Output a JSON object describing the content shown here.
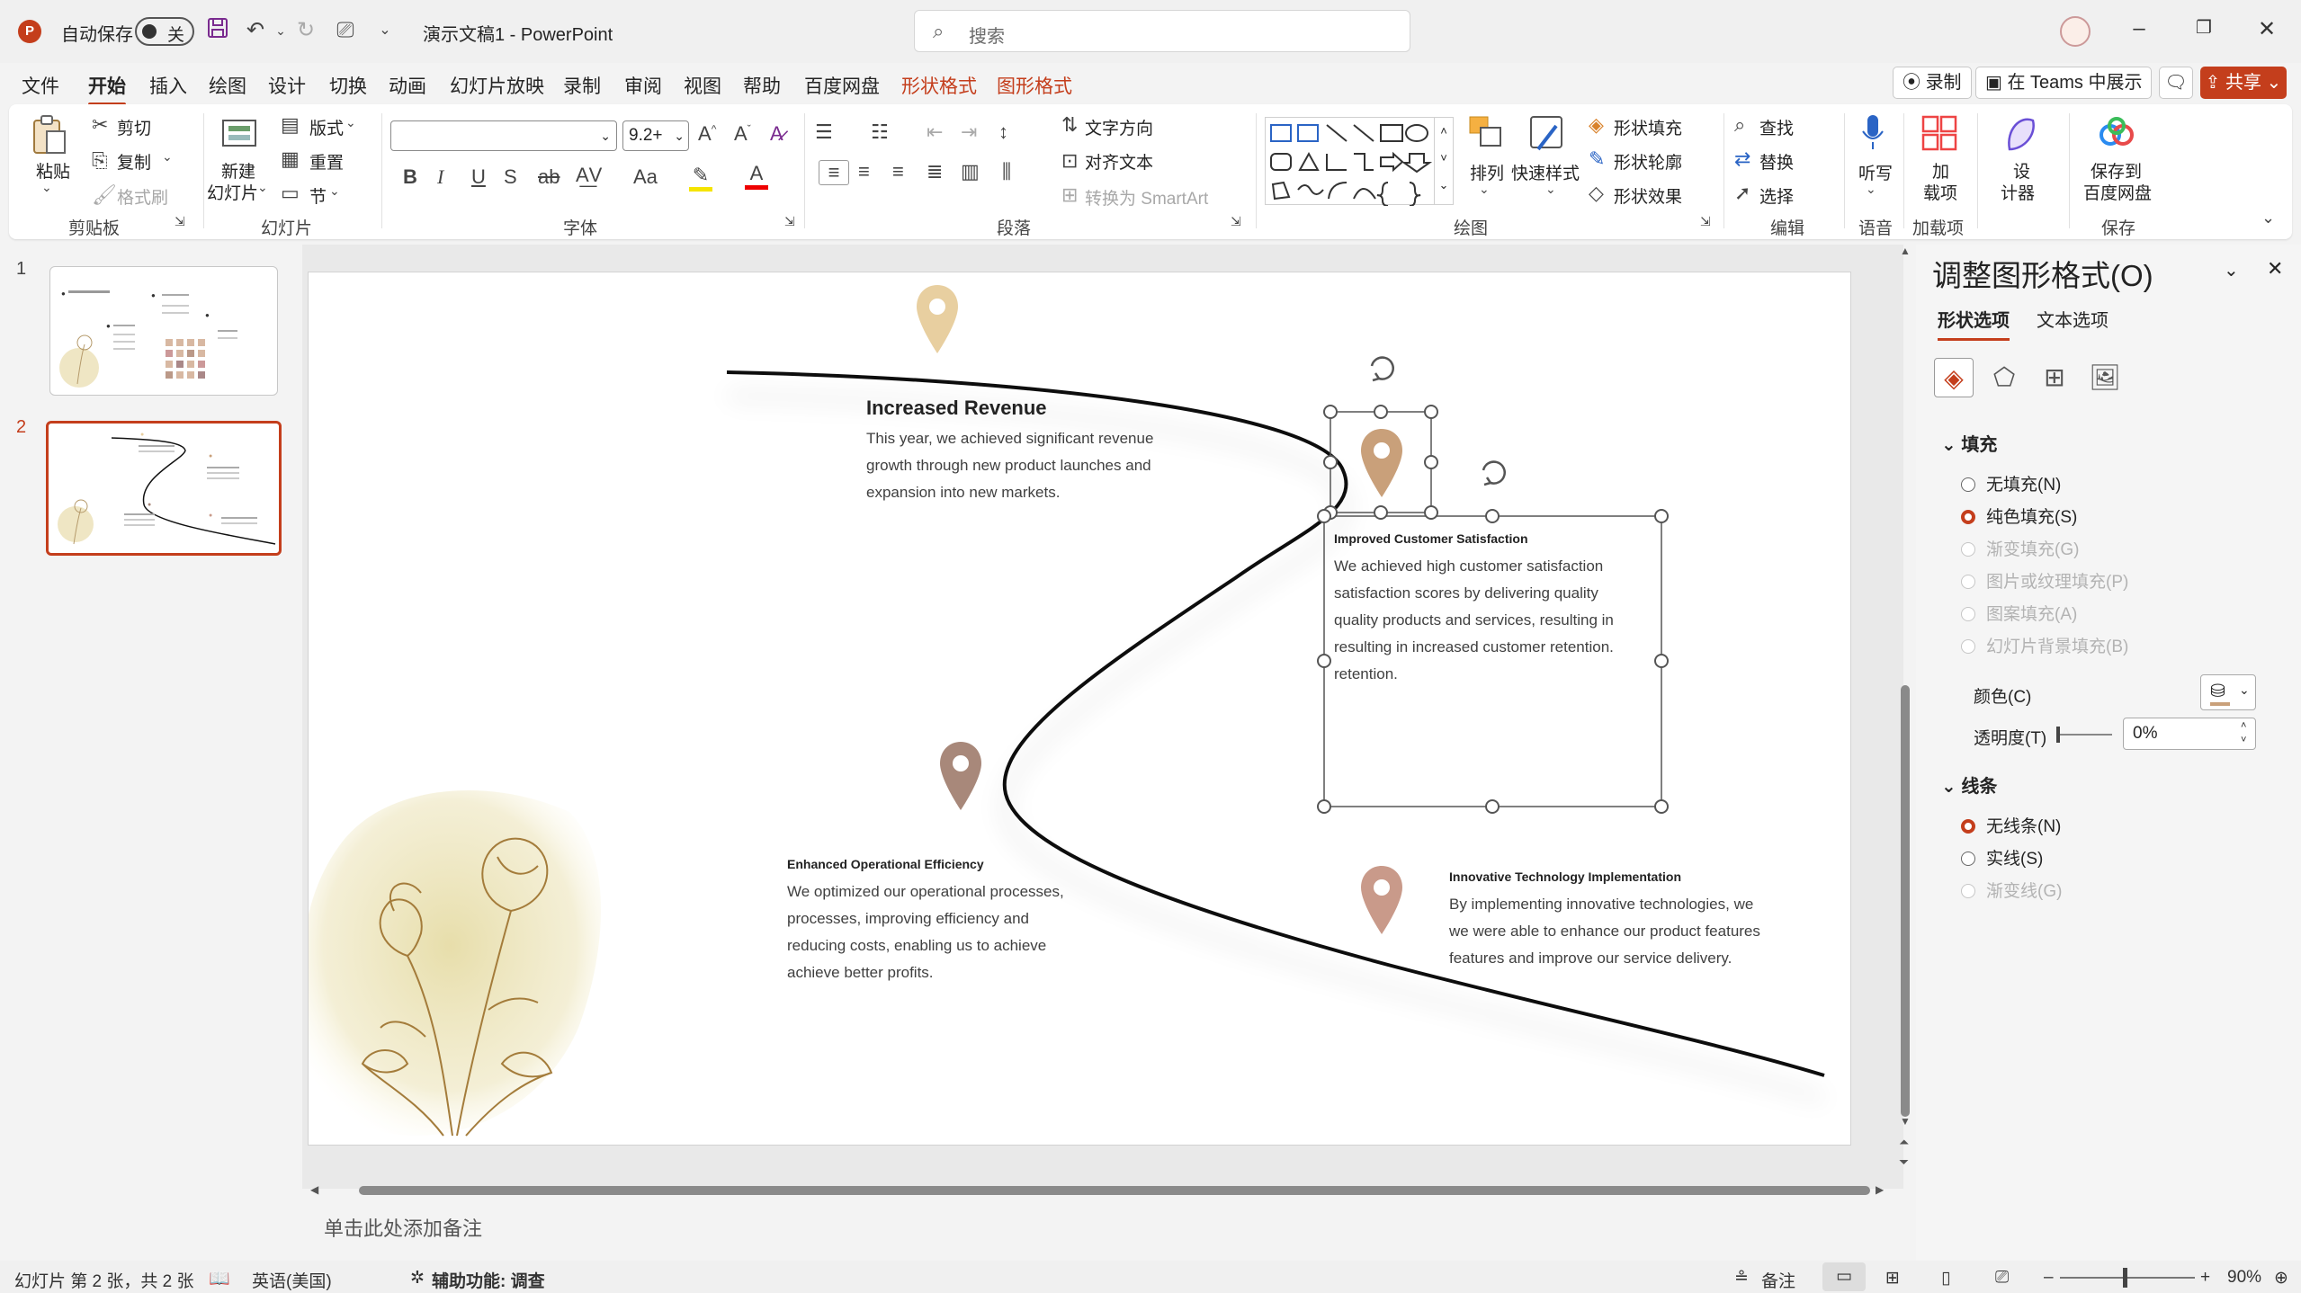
{
  "titlebar": {
    "autosave_label": "自动保存",
    "autosave_state": "关",
    "doc_title": "演示文稿1  -  PowerPoint",
    "search_placeholder": "搜索"
  },
  "menu": {
    "tabs": [
      "文件",
      "开始",
      "插入",
      "绘图",
      "设计",
      "切换",
      "动画",
      "幻灯片放映",
      "录制",
      "审阅",
      "视图",
      "帮助",
      "百度网盘",
      "形状格式",
      "图形格式"
    ],
    "active": "开始",
    "record_label": "录制",
    "teams_label": "在 Teams 中展示",
    "share_label": "共享"
  },
  "ribbon": {
    "clipboard": {
      "paste": "粘贴",
      "cut": "剪切",
      "copy": "复制",
      "format_painter": "格式刷",
      "label": "剪贴板"
    },
    "slides": {
      "new_slide_1": "新建",
      "new_slide_2": "幻灯片",
      "layout": "版式",
      "reset": "重置",
      "section": "节",
      "label": "幻灯片"
    },
    "font": {
      "font_name": "",
      "font_size": "9.2+",
      "label": "字体"
    },
    "paragraph": {
      "text_direction": "文字方向",
      "align_text": "对齐文本",
      "smartart": "转换为 SmartArt",
      "label": "段落"
    },
    "drawing": {
      "arrange": "排列",
      "quick_styles": "快速样式",
      "shape_fill": "形状填充",
      "shape_outline": "形状轮廓",
      "shape_effects": "形状效果",
      "label": "绘图"
    },
    "editing": {
      "find": "查找",
      "replace": "替换",
      "select": "选择",
      "label": "编辑"
    },
    "voice": {
      "dictate": "听写",
      "label": "语音"
    },
    "addins": {
      "addins_1": "加",
      "addins_2": "载项",
      "label": "加载项"
    },
    "designer": {
      "d1": "设",
      "d2": "计器"
    },
    "save": {
      "s1": "保存到",
      "s2": "百度网盘",
      "label": "保存"
    }
  },
  "thumbnails": {
    "numbers": [
      "1",
      "2"
    ],
    "selected": 2
  },
  "slide": {
    "items": [
      {
        "heading": "Increased Revenue",
        "body": [
          "This year, we achieved significant revenue",
          "growth through new product launches and",
          "expansion into new markets."
        ],
        "pin_color": "#e8cfa0"
      },
      {
        "heading": "Improved Customer Satisfaction",
        "body": [
          "We achieved high customer satisfaction",
          "satisfaction scores by delivering quality",
          "quality products and services, resulting in",
          "resulting in increased customer retention.",
          "retention."
        ],
        "pin_color": "#c9a07a"
      },
      {
        "heading": "Enhanced Operational Efficiency",
        "body": [
          "We optimized our operational processes,",
          "processes, improving efficiency and",
          "reducing costs, enabling us to achieve",
          "achieve better profits."
        ],
        "pin_color": "#a8887a"
      },
      {
        "heading": "Innovative Technology Implementation",
        "body": [
          "By implementing innovative technologies, we",
          "we were able to enhance our product features",
          "features and improve our service delivery."
        ],
        "pin_color": "#c99a8a"
      }
    ]
  },
  "notes_placeholder": "单击此处添加备注",
  "pane": {
    "title": "调整图形格式(O)",
    "tab_shape": "形状选项",
    "tab_text": "文本选项",
    "fill_section": "填充",
    "fill_options": [
      "无填充(N)",
      "纯色填充(S)",
      "渐变填充(G)",
      "图片或纹理填充(P)",
      "图案填充(A)",
      "幻灯片背景填充(B)"
    ],
    "fill_selected": 1,
    "color_label": "颜色(C)",
    "transparency_label": "透明度(T)",
    "transparency_value": "0%",
    "line_section": "线条",
    "line_options": [
      "无线条(N)",
      "实线(S)",
      "渐变线(G)"
    ],
    "line_selected": 0
  },
  "status": {
    "slide_info": "幻灯片 第 2 张，共 2 张",
    "language": "英语(美国)",
    "accessibility": "辅助功能: 调查",
    "notes": "备注",
    "zoom": "90%"
  },
  "colors": {
    "accent": "#c43e1c",
    "pin_light": "#e8cfa0",
    "pin_mid": "#c9a07a",
    "pin_dark": "#a8887a",
    "pin_rose": "#c99a8a"
  }
}
